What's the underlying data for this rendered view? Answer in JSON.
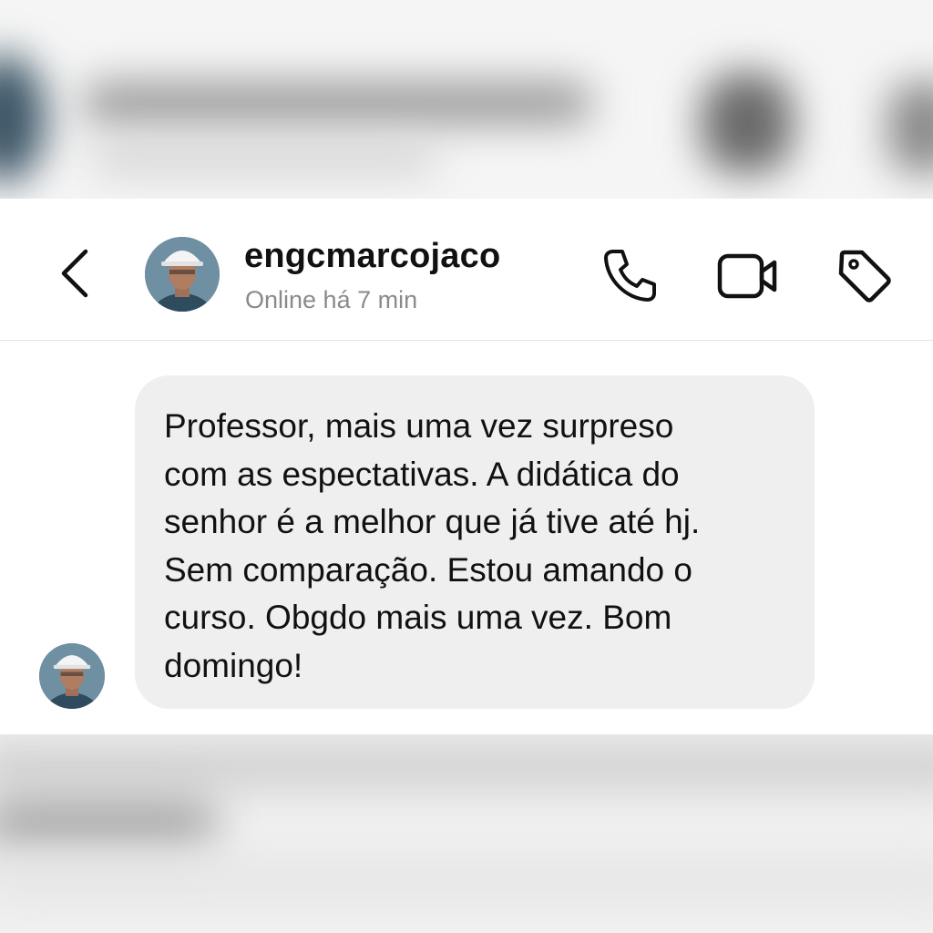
{
  "header": {
    "username": "engcmarcojaco",
    "status": "Online há 7 min",
    "avatar_icon": "engineer-avatar",
    "back_icon": "chevron-left-icon",
    "actions": [
      {
        "name": "call",
        "icon": "phone-icon"
      },
      {
        "name": "video",
        "icon": "video-camera-icon"
      },
      {
        "name": "tag",
        "icon": "tag-icon"
      }
    ]
  },
  "messages": [
    {
      "sender": "engcmarcojaco",
      "text": "Professor, mais uma vez surpreso\ncom as espectativas. A didática do\nsenhor é a melhor que já tive até hj.\nSem comparação. Estou amando o\ncurso. Obgdo mais uma vez. Bom\ndomingo!"
    }
  ],
  "colors": {
    "bubble": "#efefef",
    "text": "#111111",
    "status": "#8a8a8a",
    "background": "#ffffff"
  }
}
